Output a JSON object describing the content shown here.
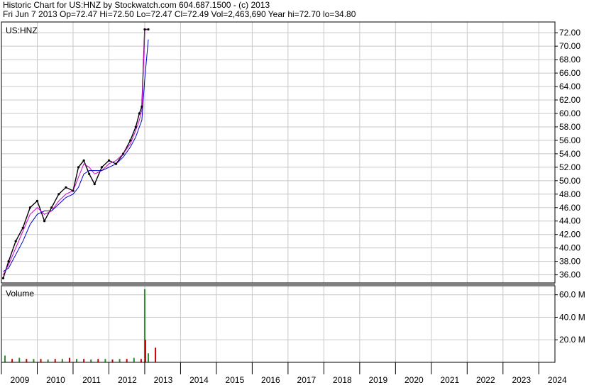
{
  "header": {
    "line1": "Historic Chart for US:HNZ by Stockwatch.com 604.687.1500 - (c) 2013",
    "line2": "Fri Jun  7 2013   Op=72.47   Hi=72.50   Lo=72.47   Cl=72.49   Vol=2,463,690   Year hi=72.70   lo=34.80"
  },
  "colors": {
    "grid": "#c8c8c8",
    "price": "#000000",
    "ma_short": "#d000d0",
    "ma_long": "#0000cc",
    "vol_up": "#2e8b2e",
    "vol_down": "#cc0000"
  },
  "chart_data": [
    {
      "type": "line",
      "title": "US:HNZ",
      "ylim": [
        34.8,
        73.6
      ],
      "y_ticks": [
        "72.00",
        "70.00",
        "68.00",
        "66.00",
        "64.00",
        "62.00",
        "60.00",
        "58.00",
        "56.00",
        "54.00",
        "52.00",
        "50.00",
        "48.00",
        "46.00",
        "44.00",
        "42.00",
        "40.00",
        "38.00",
        "36.00"
      ],
      "x_ticks": [
        "2009",
        "2010",
        "2011",
        "2012",
        "2013",
        "2014",
        "2015",
        "2016",
        "2017",
        "2018",
        "2019",
        "2020",
        "2021",
        "2022",
        "2023",
        "2024"
      ],
      "x": [
        2009.05,
        2009.2,
        2009.4,
        2009.6,
        2009.8,
        2010.0,
        2010.2,
        2010.4,
        2010.6,
        2010.8,
        2011.0,
        2011.15,
        2011.3,
        2011.45,
        2011.6,
        2011.8,
        2012.0,
        2012.2,
        2012.4,
        2012.6,
        2012.75,
        2012.85,
        2012.92,
        2013.0,
        2013.1
      ],
      "series": [
        {
          "name": "",
          "values": [
            35.5,
            38,
            41,
            43,
            46,
            47,
            44,
            46,
            48,
            49,
            48.5,
            52,
            53,
            51,
            49.5,
            52,
            53,
            52.5,
            54,
            56,
            58,
            60,
            61,
            72.5,
            72.5
          ]
        },
        {
          "name": "",
          "values": [
            36,
            37.5,
            40,
            42.5,
            45,
            46,
            45,
            45.5,
            47,
            48,
            48.5,
            50.5,
            52.5,
            52,
            51,
            51.5,
            52.5,
            53,
            54,
            55.5,
            57.5,
            59,
            60.5,
            72.4,
            72.5
          ]
        },
        {
          "name": "",
          "values": [
            36.5,
            37,
            39,
            41,
            43.5,
            45,
            45.5,
            45.5,
            46.5,
            47.5,
            48,
            49,
            51,
            51.5,
            51.5,
            51.5,
            52,
            52.5,
            53.5,
            55,
            56.5,
            58,
            59,
            65,
            71
          ]
        }
      ]
    },
    {
      "type": "bar",
      "title": "Volume",
      "ylim": [
        0,
        68
      ],
      "y_ticks": [
        "60.0 M",
        "40.0 M",
        "20.0 M"
      ],
      "x": [
        2009.1,
        2009.3,
        2009.5,
        2009.7,
        2009.9,
        2010.1,
        2010.3,
        2010.5,
        2010.7,
        2010.9,
        2011.1,
        2011.3,
        2011.5,
        2011.7,
        2011.9,
        2012.1,
        2012.3,
        2012.5,
        2012.7,
        2012.9,
        2013.0,
        2013.02,
        2013.1,
        2013.3
      ],
      "values": [
        6,
        3,
        4,
        3,
        3,
        3,
        2.5,
        3,
        3,
        4,
        3,
        3,
        2.5,
        3,
        3,
        2.5,
        3,
        3,
        4,
        3,
        65,
        20,
        8,
        13
      ]
    }
  ]
}
